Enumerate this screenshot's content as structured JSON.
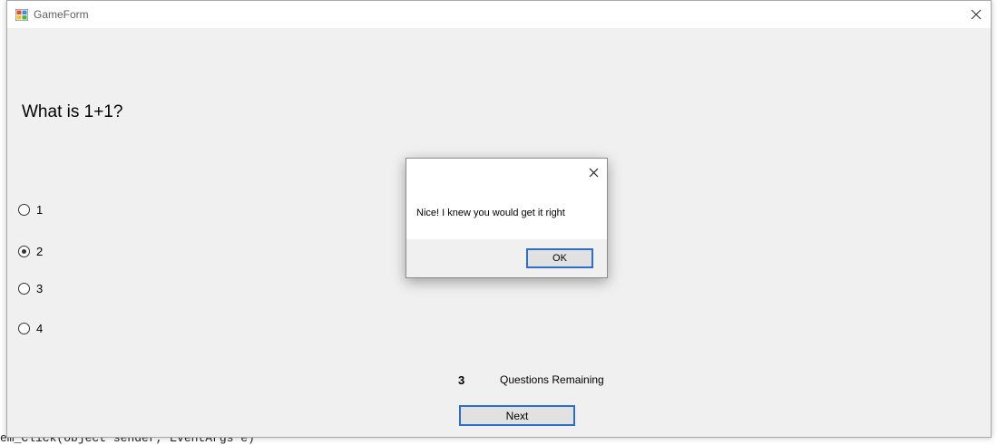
{
  "window": {
    "title": "GameForm"
  },
  "quiz": {
    "question": "What is 1+1?",
    "options": [
      {
        "label": "1",
        "checked": false
      },
      {
        "label": "2",
        "checked": true
      },
      {
        "label": "3",
        "checked": false
      },
      {
        "label": "4",
        "checked": false
      }
    ],
    "remaining_count": "3",
    "remaining_label": "Questions Remaining",
    "next_label": "Next"
  },
  "dialog": {
    "message": "Nice! I knew you would get it right",
    "ok_label": "OK"
  },
  "background_code": {
    "bottom_line": "em_Click(object sender, EventArgs e)"
  },
  "colors": {
    "accent": "#2d6ec7",
    "window_bg": "#f0f0f0"
  }
}
